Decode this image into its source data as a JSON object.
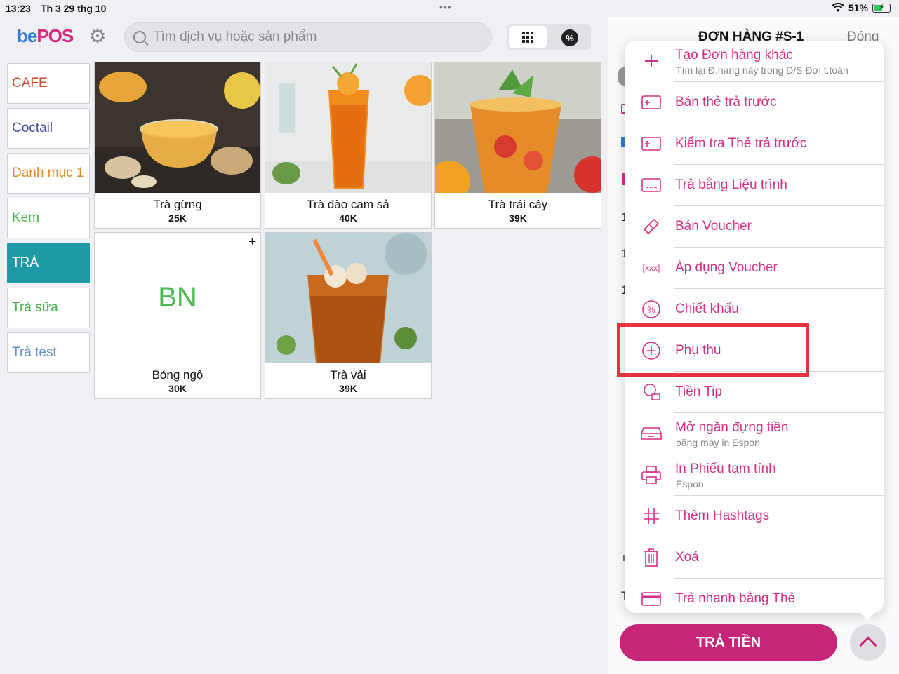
{
  "status_bar": {
    "time": "13:23",
    "date": "Th 3 29 thg 10",
    "battery": "51%"
  },
  "header": {
    "logo_be": "be",
    "logo_pos": "POS",
    "search_placeholder": "Tìm dịch vụ hoặc sản phẩm"
  },
  "categories": [
    {
      "label": "CAFE",
      "color": "#c94a2a"
    },
    {
      "label": "Coctail",
      "color": "#3f4fa0"
    },
    {
      "label": "Danh mục 1",
      "color": "#e08b2a"
    },
    {
      "label": "Kem",
      "color": "#49b14a"
    },
    {
      "label": "TRÀ",
      "color": "#ffffff",
      "active": true
    },
    {
      "label": "Trà sữa",
      "color": "#49b14a"
    },
    {
      "label": "Trà test",
      "color": "#6a8fc8"
    }
  ],
  "products": [
    {
      "name": "Trà gừng",
      "price": "25K"
    },
    {
      "name": "Trà đào cam sả",
      "price": "40K"
    },
    {
      "name": "Trà trái cây",
      "price": "39K"
    },
    {
      "name": "Bỏng ngô",
      "price": "30K",
      "initials": "BN",
      "add": "+"
    },
    {
      "name": "Trà vải",
      "price": "39K"
    }
  ],
  "order": {
    "title": "ĐƠN HÀNG #S-1",
    "close": "Đóng"
  },
  "menu": [
    {
      "label": "Tạo Đơn hàng khác",
      "sub": "Tìm lại Đ.hàng này trong D/S Đợi t.toán",
      "icon": "plus-icon"
    },
    {
      "label": "Bán thẻ trả trước",
      "icon": "prepaid-card-icon"
    },
    {
      "label": "Kiểm tra Thẻ trả trước",
      "icon": "prepaid-card-check-icon"
    },
    {
      "label": "Trả bằng Liệu trình",
      "icon": "treatment-card-icon"
    },
    {
      "label": "Bán Voucher",
      "icon": "voucher-ticket-icon"
    },
    {
      "label": "Áp dụng Voucher",
      "icon": "voucher-code-icon",
      "icon_text": "[xxx]"
    },
    {
      "label": "Chiết khấu",
      "icon": "discount-percent-icon"
    },
    {
      "label": "Phụ thu",
      "icon": "surcharge-plus-icon"
    },
    {
      "label": "Tiền Tip",
      "icon": "tip-person-icon"
    },
    {
      "label": "Mở ngăn đựng tiền",
      "sub": "bằng máy in Espon",
      "icon": "cash-drawer-icon"
    },
    {
      "label": "In Phiếu tạm tính",
      "sub": "Espon",
      "icon": "printer-icon"
    },
    {
      "label": "Thêm Hashtags",
      "icon": "hashtag-icon"
    },
    {
      "label": "Xoá",
      "icon": "trash-icon"
    },
    {
      "label": "Trả nhanh bằng Thẻ",
      "icon": "credit-card-icon"
    }
  ],
  "pay_button": "TRẢ TIỀN",
  "colors": {
    "accent": "#d62f86",
    "pay": "#c72577",
    "active_category": "#1f9aa5",
    "highlight": "#e8323e"
  }
}
